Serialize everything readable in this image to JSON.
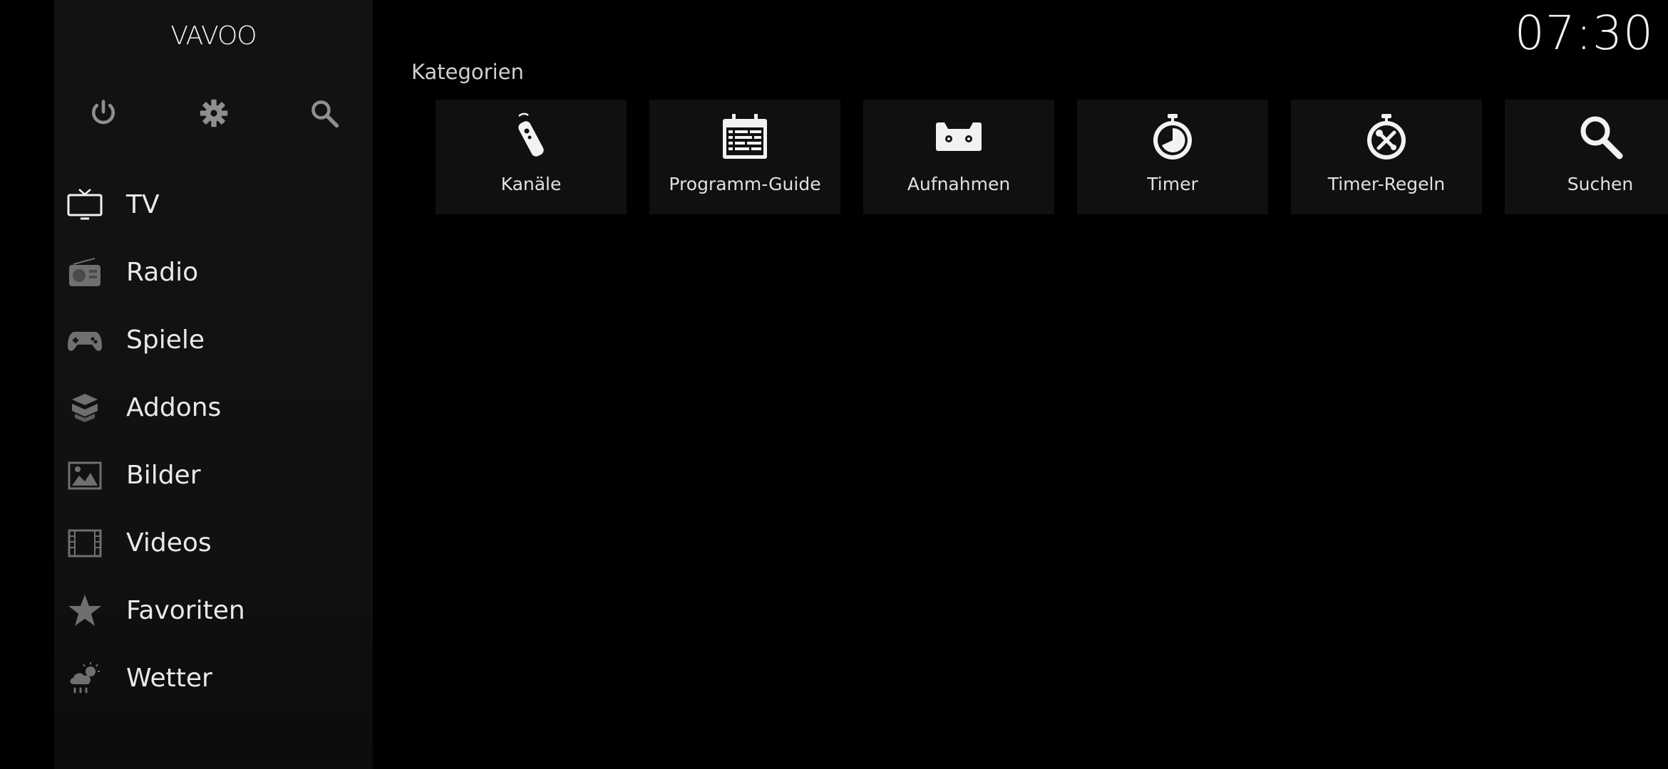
{
  "app": {
    "logo": "VAVOO"
  },
  "clock": {
    "time": "07:30"
  },
  "top_icons": [
    {
      "name": "power-icon"
    },
    {
      "name": "settings-icon"
    },
    {
      "name": "search-icon"
    }
  ],
  "menu": {
    "items": [
      {
        "label": "TV",
        "icon": "tv-icon"
      },
      {
        "label": "Radio",
        "icon": "radio-icon"
      },
      {
        "label": "Spiele",
        "icon": "gamepad-icon"
      },
      {
        "label": "Addons",
        "icon": "addons-box-icon"
      },
      {
        "label": "Bilder",
        "icon": "pictures-icon"
      },
      {
        "label": "Videos",
        "icon": "film-icon"
      },
      {
        "label": "Favoriten",
        "icon": "star-icon"
      },
      {
        "label": "Wetter",
        "icon": "weather-icon"
      }
    ]
  },
  "categories": {
    "title": "Kategorien",
    "tiles": [
      {
        "label": "Kanäle",
        "icon": "remote-icon"
      },
      {
        "label": "Programm-Guide",
        "icon": "calendar-guide-icon"
      },
      {
        "label": "Aufnahmen",
        "icon": "cassette-icon"
      },
      {
        "label": "Timer",
        "icon": "stopwatch-icon"
      },
      {
        "label": "Timer-Regeln",
        "icon": "timer-rules-icon"
      },
      {
        "label": "Suchen",
        "icon": "search-icon"
      }
    ]
  },
  "colors": {
    "background": "#000000",
    "sidebar": "#121212",
    "tile": "#101010",
    "text": "#e6e6e6",
    "icon_muted": "#8a8a8a"
  }
}
